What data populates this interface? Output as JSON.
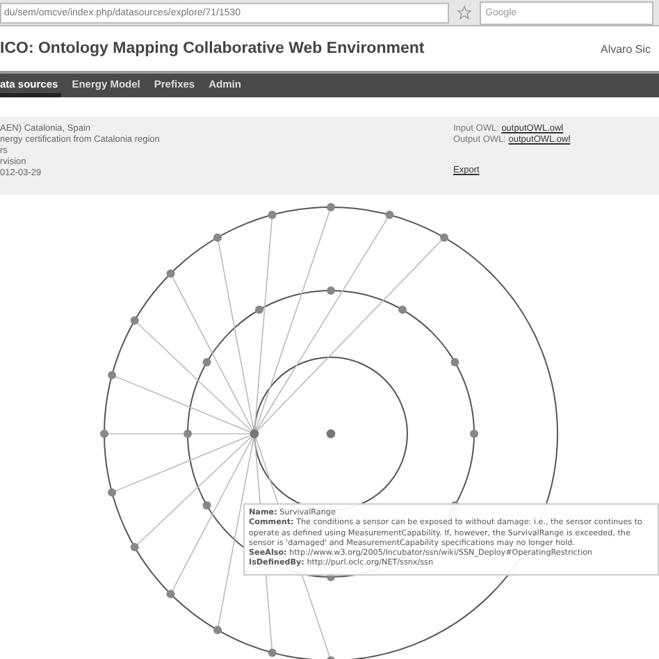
{
  "browser": {
    "url": "du/sem/omcve/index.php/datasources/explore/71/1530",
    "search_placeholder": "Google"
  },
  "header": {
    "title": "ICO: Ontology Mapping Collaborative Web Environment",
    "user": "Alvaro Sic"
  },
  "nav": [
    {
      "label": "ata sources",
      "selected": true
    },
    {
      "label": "Energy Model",
      "selected": false
    },
    {
      "label": "Prefixes",
      "selected": false
    },
    {
      "label": "Admin",
      "selected": false
    }
  ],
  "info": {
    "details": [
      "AEN) Catalonia, Spain",
      "nergy certification from Catalonia region",
      "rs",
      "rvision",
      "012-03-29"
    ],
    "files": [
      {
        "label": "Input OWL:",
        "link": "outputOWL.owl"
      },
      {
        "label": "Output OWL:",
        "link": "outputOWL.owl"
      }
    ],
    "export": "Export"
  },
  "tooltip": [
    "**Name:** SurvivalRange",
    "**Comment:** The conditions a sensor can be exposed to without damage: i.e., the sensor continues to operate as defined using MeasurementCapability. If, however, the SurvivalRange is exceeded, the sensor is 'damaged' and MeasurementCapability specifications may no longer hold.",
    "**SeeAlso:** http://www.w3.org/2005/Incubator/ssn/wiki/SSN_Deploy#OperatingRestriction",
    "**IsDefinedBy:** http://purl.oclc.org/NET/ssnx/ssn"
  ]
}
